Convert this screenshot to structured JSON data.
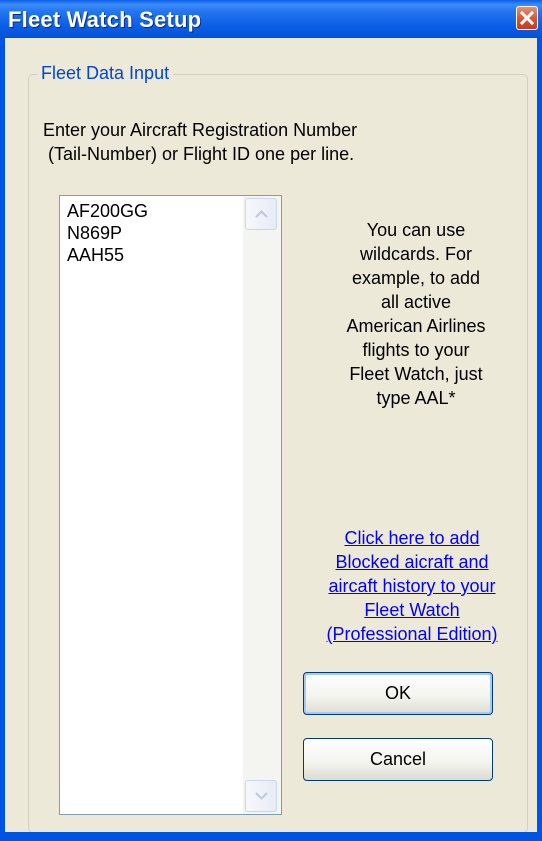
{
  "window": {
    "title": "Fleet Watch Setup"
  },
  "group": {
    "legend": "Fleet Data Input"
  },
  "instructions": {
    "line1": "Enter your Aircraft Registration Number",
    "line2": " (Tail-Number) or Flight ID one per line."
  },
  "list": {
    "lines": [
      "AF200GG",
      "N869P",
      "AAH55"
    ]
  },
  "hint": {
    "lines": [
      "You can use",
      "wildcards. For",
      "example, to add",
      "all active",
      "American Airlines",
      "flights to your",
      "Fleet Watch, just",
      "type AAL*"
    ]
  },
  "link": {
    "lines": [
      "Click here to add",
      "Blocked aicraft and",
      "aircaft history to your",
      "Fleet Watch",
      "(Professional Edition)"
    ]
  },
  "buttons": {
    "ok": "OK",
    "cancel": "Cancel"
  },
  "icons": {
    "close": "close-icon",
    "scroll_up": "chevron-up-icon",
    "scroll_down": "chevron-down-icon"
  },
  "colors": {
    "title_bar": "#0054e3",
    "link": "#0000ff",
    "legend": "#0046d5",
    "dialog_bg": "#ece9d8"
  }
}
